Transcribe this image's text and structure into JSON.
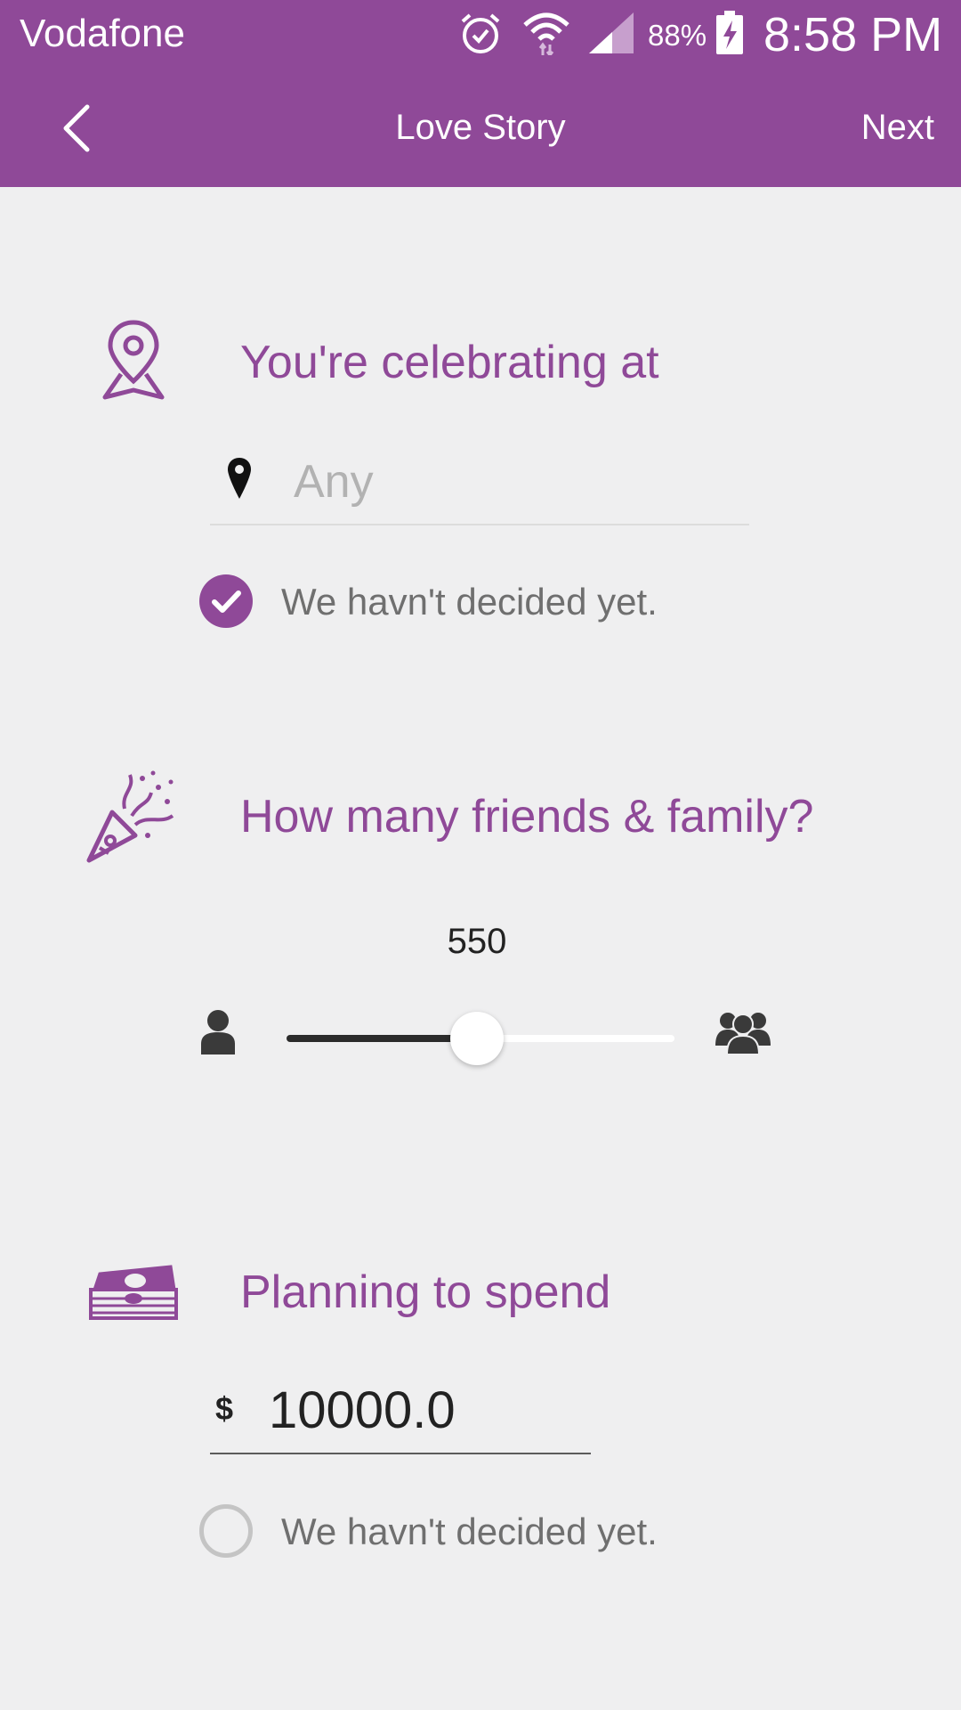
{
  "status_bar": {
    "carrier": "Vodafone",
    "battery": "88%",
    "time": "8:58 PM",
    "icons": [
      "alarm-icon",
      "wifi-icon",
      "signal-icon",
      "battery-charging-icon"
    ]
  },
  "app_bar": {
    "title": "Love Story",
    "next_label": "Next",
    "back_icon": "chevron-left-icon"
  },
  "location_section": {
    "title": "You're celebrating at",
    "icon": "map-pin-icon",
    "input_placeholder": "Any",
    "input_value": "",
    "undecided_label": "We havn't decided yet.",
    "undecided_checked": true
  },
  "guests_section": {
    "title": "How many friends & family?",
    "icon": "party-popper-icon",
    "value_label": "550",
    "slider_fraction": 0.49,
    "min_icon": "person-icon",
    "max_icon": "group-icon"
  },
  "budget_section": {
    "title": "Planning to spend",
    "icon": "money-stack-icon",
    "currency_symbol": "$",
    "amount": "10000.0",
    "undecided_label": "We havn't decided yet.",
    "undecided_checked": false
  },
  "colors": {
    "brand": "#8f4998",
    "background": "#efeff0",
    "text_muted": "#6f6f6f"
  }
}
